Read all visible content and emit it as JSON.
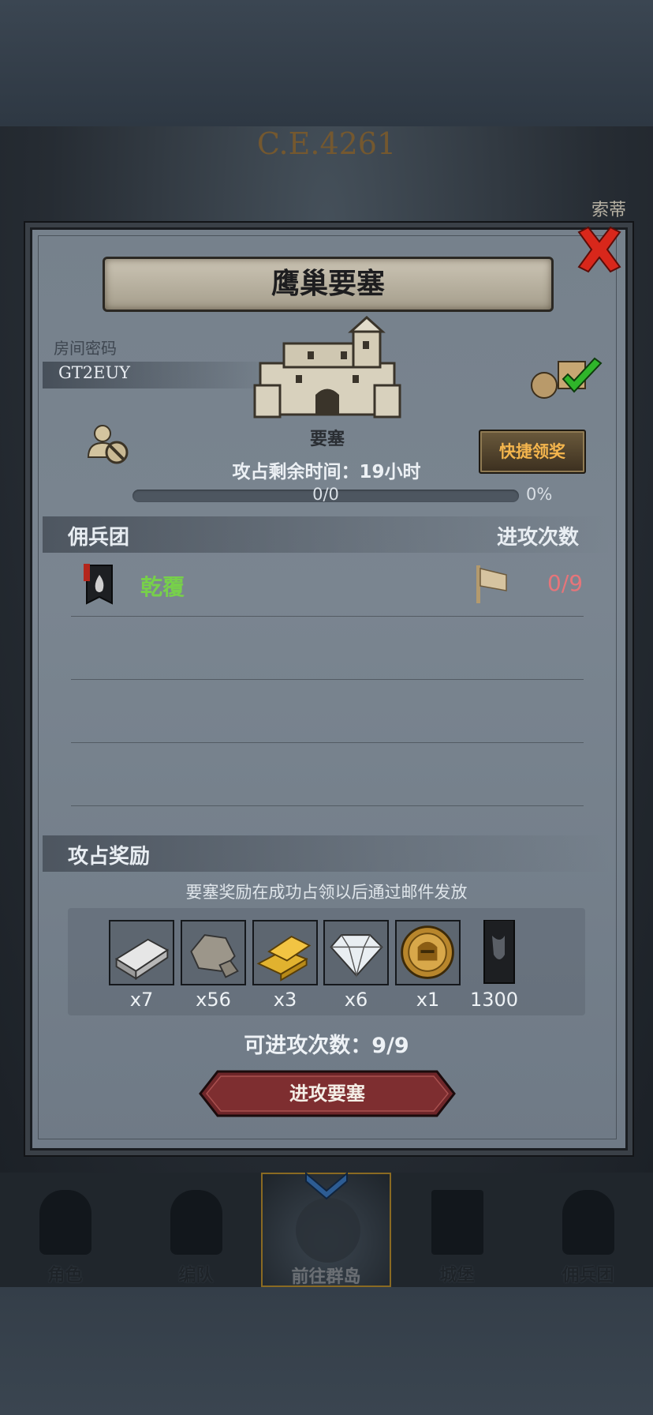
{
  "background": {
    "year": "C.E.4261",
    "top_right_label": "索蒂"
  },
  "modal": {
    "title": "鹰巢要塞",
    "room_code_label": "房间密码",
    "room_code": "GT2EUY",
    "fortress_label": "要塞",
    "quick_claim_label": "快捷领奖",
    "remaining_time_text": "攻占剩余时间：19小时",
    "progress": {
      "count_text": "0/0",
      "percent_text": "0%",
      "fraction": 0
    },
    "mercenary_section": {
      "title": "佣兵团",
      "attack_count_header": "进攻次数",
      "rows": [
        {
          "name": "乾覆",
          "attacks": "0/9"
        }
      ]
    },
    "reward_section": {
      "title": "攻占奖励",
      "notice": "要塞奖励在成功占领以后通过邮件发放",
      "items": [
        {
          "icon": "iron-ingot-icon",
          "qty": "x7"
        },
        {
          "icon": "stone-ore-icon",
          "qty": "x56"
        },
        {
          "icon": "gold-bars-icon",
          "qty": "x3"
        },
        {
          "icon": "diamond-icon",
          "qty": "x6"
        },
        {
          "icon": "knight-medal-icon",
          "qty": "x1"
        },
        {
          "icon": "mercenary-banner-icon",
          "qty": "1300"
        }
      ]
    },
    "attacks_available_text": "可进攻次数：9/9",
    "attack_button_label": "进攻要塞"
  },
  "bottom_nav": {
    "items": [
      {
        "label": "角色",
        "active": false
      },
      {
        "label": "编队",
        "active": false
      },
      {
        "label": "前往群岛",
        "active": true
      },
      {
        "label": "城堡",
        "active": false
      },
      {
        "label": "佣兵团",
        "active": false
      }
    ]
  },
  "colors": {
    "accent_gold": "#f4b54d",
    "merc_name_green": "#77d04a",
    "attack_count_red": "#e6757a",
    "attack_button": "#7a2a2c"
  }
}
